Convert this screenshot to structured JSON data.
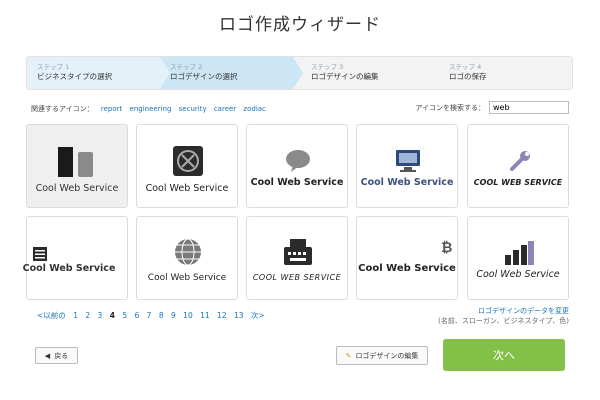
{
  "title": "ロゴ作成ウィザード",
  "steps": [
    {
      "num": "ステップ 1",
      "label": "ビジネスタイプの選択"
    },
    {
      "num": "ステップ 2",
      "label": "ロゴデザインの選択"
    },
    {
      "num": "ステップ 3",
      "label": "ロゴデザインの編集"
    },
    {
      "num": "ステップ 4",
      "label": "ロゴの保存"
    }
  ],
  "related": {
    "label": "関連するアイコン：",
    "tags": [
      "report",
      "engineering",
      "security",
      "career",
      "zodiac"
    ]
  },
  "search": {
    "label": "アイコンを検索する：",
    "value": "web"
  },
  "logos": [
    {
      "text": "Cool Web Service",
      "icon": "two-blocks-icon"
    },
    {
      "text": "Cool Web Service",
      "icon": "safe-icon"
    },
    {
      "text": "Cool Web Service",
      "icon": "speech-bubble-icon"
    },
    {
      "text": "Cool Web Service",
      "icon": "computer-monitor-icon"
    },
    {
      "text": "COOL WEB SERVICE",
      "icon": "wrench-icon"
    },
    {
      "text": "Cool Web Service",
      "icon": "list-icon"
    },
    {
      "text": "Cool Web Service",
      "icon": "globe-icon"
    },
    {
      "text": "COOL WEB SERVICE",
      "icon": "typewriter-icon"
    },
    {
      "text": "Cool Web Service",
      "icon": "bitcoin-icon"
    },
    {
      "text": "Cool Web Service",
      "icon": "bar-chart-icon"
    }
  ],
  "pager": {
    "prev": "<以前の",
    "pages": [
      "1",
      "2",
      "3",
      "4",
      "5",
      "6",
      "7",
      "8",
      "9",
      "10",
      "11",
      "12",
      "13"
    ],
    "current": "4",
    "next": "次>"
  },
  "edit_data": {
    "link": "ロゴデザインのデータを変更",
    "sub": "(名前、スローガン、ビジネスタイプ、色)"
  },
  "buttons": {
    "back": "戻る",
    "edit_logo": "ロゴデザインの編集",
    "next": "次へ"
  },
  "colors": {
    "accent_green": "#83c047",
    "link_blue": "#1a75b8",
    "step_active": "#cde6f5"
  }
}
